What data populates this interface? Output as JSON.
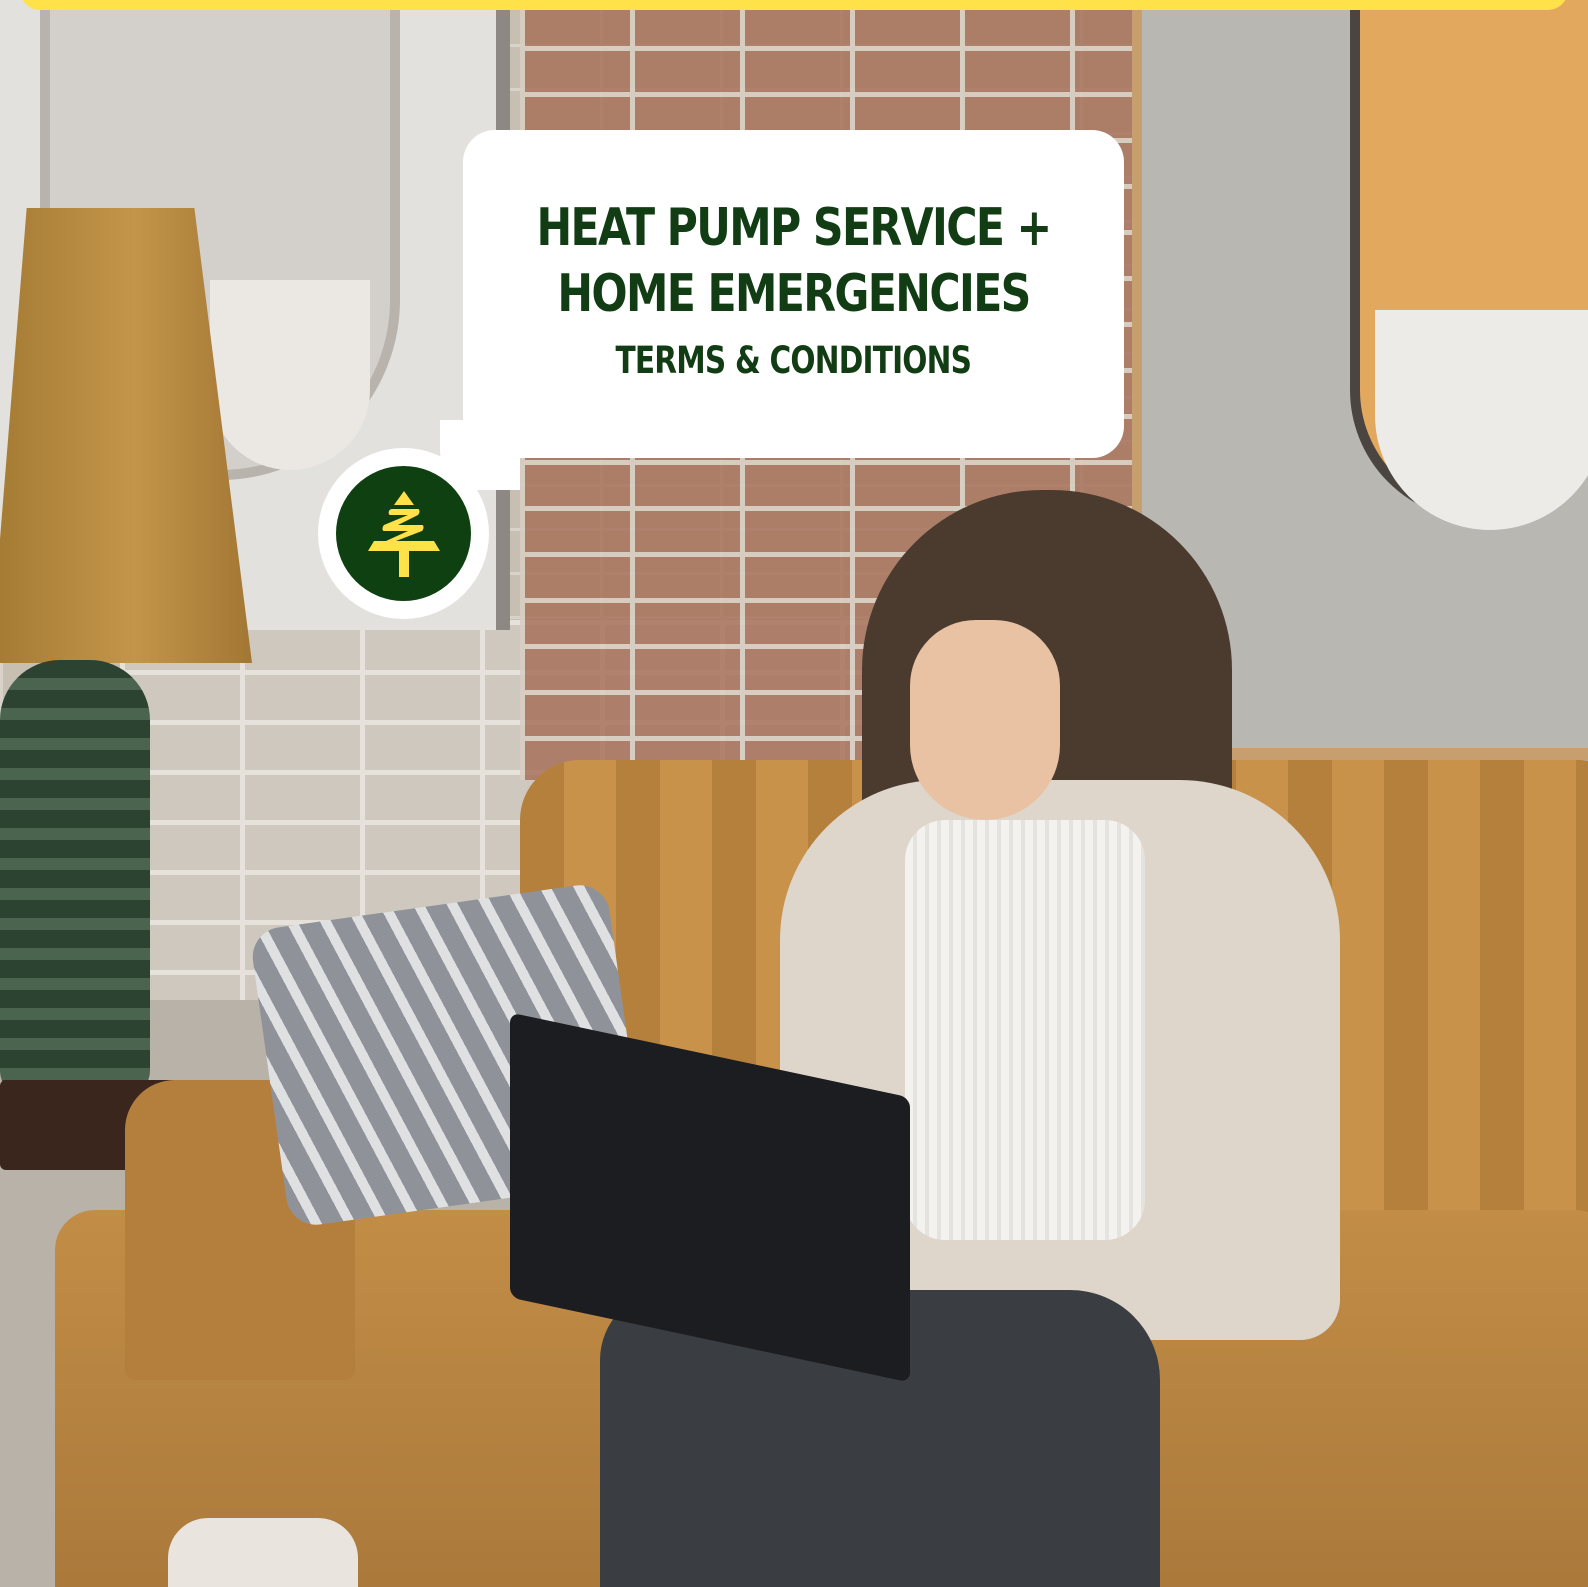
{
  "banner": {
    "title_line1": "HEAT PUMP SERVICE +",
    "title_line2": "HOME EMERGENCIES",
    "subtitle": "TERMS & CONDITIONS"
  },
  "logo": {
    "icon": "tree-logo-icon"
  },
  "colors": {
    "brand_green": "#0f4011",
    "accent_yellow": "#ffe14a",
    "text_green": "#123d14"
  },
  "photo": {
    "description_icon": "photo-background"
  }
}
